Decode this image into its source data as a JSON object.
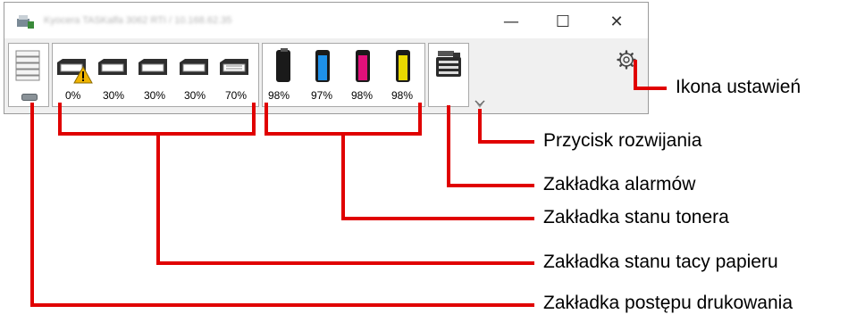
{
  "window": {
    "title": "Kyocera TASKalfa 3062 RTI / 10.168.62.35",
    "controls": {
      "minimize": "—",
      "maximize": "☐",
      "close": "✕"
    }
  },
  "tabs": {
    "tray": {
      "levels": [
        "0%",
        "30%",
        "30%",
        "30%",
        "70%"
      ]
    },
    "toner": {
      "levels": [
        "98%",
        "97%",
        "98%",
        "98%"
      ]
    }
  },
  "colors": {
    "callout_line": "#e00000",
    "toner_black": "#1a1a1a",
    "toner_cyan": "#1e90e8",
    "toner_magenta": "#e0107a",
    "toner_yellow": "#e8d800"
  },
  "callouts": {
    "settings_icon": "Ikona ustawień",
    "expand_button": "Przycisk rozwijania",
    "alarm_tab": "Zakładka alarmów",
    "toner_tab": "Zakładka stanu tonera",
    "paper_tray_tab": "Zakładka stanu tacy papieru",
    "print_progress_tab": "Zakładka postępu drukowania"
  }
}
